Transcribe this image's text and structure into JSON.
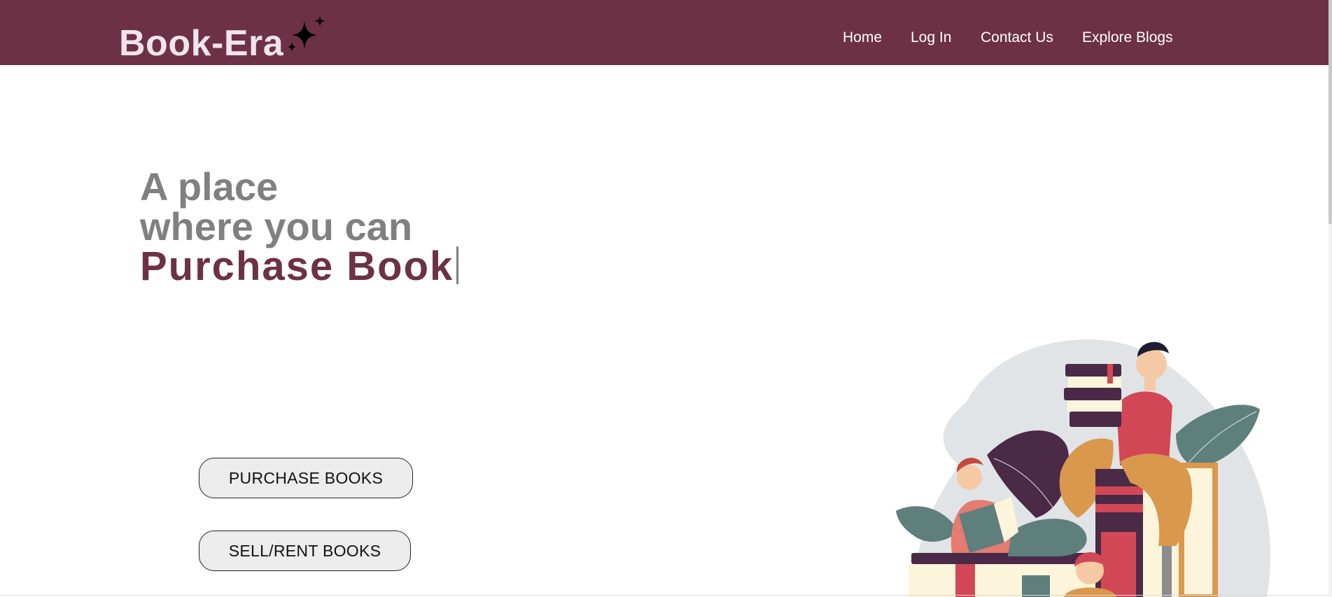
{
  "navbar": {
    "brand": "Book-Era",
    "links": {
      "home": "Home",
      "login": "Log In",
      "contact": "Contact Us",
      "blogs": "Explore Blogs"
    }
  },
  "hero": {
    "line1": "A place",
    "line2": "where you can",
    "typed_text": "Purchase Book"
  },
  "buttons": {
    "purchase": "PURCHASE BOOKS",
    "sell_rent": "SELL/RENT BOOKS"
  },
  "colors": {
    "brand_maroon": "#6d3146",
    "hero_gray": "#808080",
    "button_bg": "#ececec"
  },
  "icons": [
    "sparkle-icon",
    "readers-illustration"
  ]
}
